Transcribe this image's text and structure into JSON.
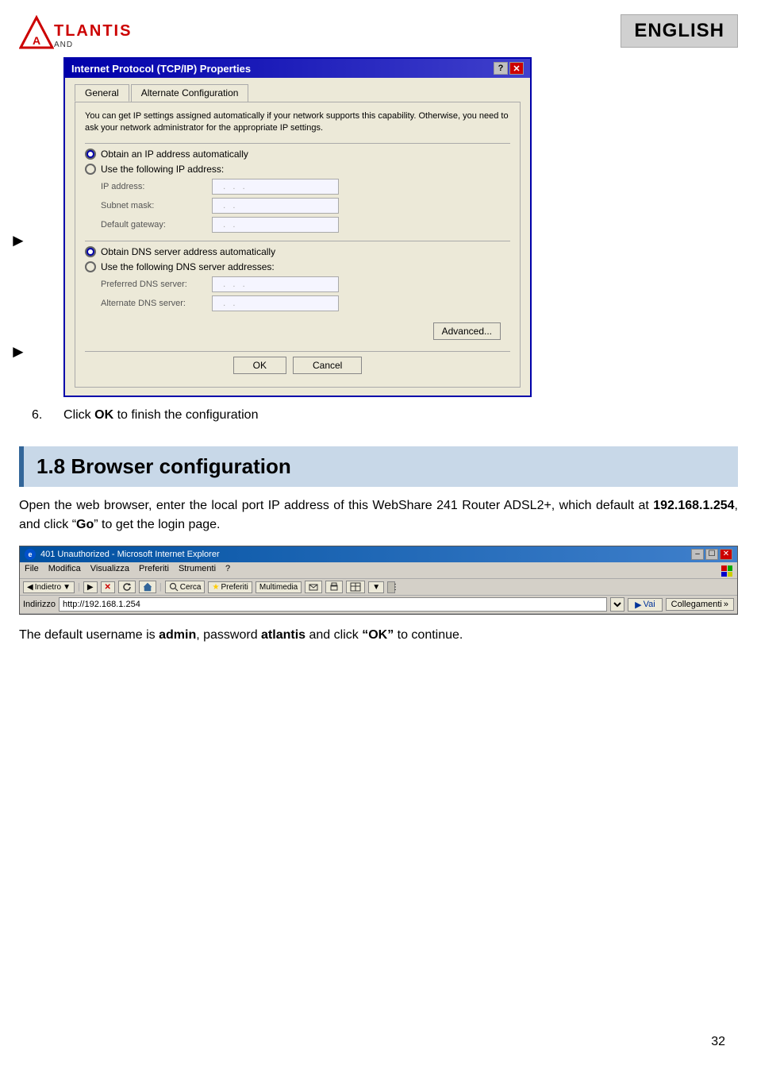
{
  "header": {
    "logo_text": "TLANTIS",
    "logo_reg": "®",
    "logo_subtitle": "AND",
    "english_badge": "ENGLISH"
  },
  "dialog": {
    "title": "Internet Protocol (TCP/IP) Properties",
    "tabs": [
      {
        "label": "General",
        "active": true
      },
      {
        "label": "Alternate Configuration",
        "active": false
      }
    ],
    "description": "You can get IP settings assigned automatically if your network supports this capability. Otherwise, you need to ask your network administrator for the appropriate IP settings.",
    "ip_section": {
      "auto_radio": "Obtain an IP address automatically",
      "manual_radio": "Use the following IP address:",
      "fields": [
        {
          "label": "IP address:",
          "value": ". . ."
        },
        {
          "label": "Subnet mask:",
          "value": ". ."
        },
        {
          "label": "Default gateway:",
          "value": ". ."
        }
      ]
    },
    "dns_section": {
      "auto_radio": "Obtain DNS server address automatically",
      "manual_radio": "Use the following DNS server addresses:",
      "fields": [
        {
          "label": "Preferred DNS server:",
          "value": ". . ."
        },
        {
          "label": "Alternate DNS server:",
          "value": ". ."
        }
      ]
    },
    "advanced_btn": "Advanced...",
    "ok_btn": "OK",
    "cancel_btn": "Cancel"
  },
  "step6": {
    "number": "6.",
    "text": "Click ",
    "bold": "OK",
    "rest": " to finish the configuration"
  },
  "section18": {
    "title": "1.8 Browser configuration",
    "body_part1": "Open the web browser, enter the local port IP address of this WebShare 241 Router ADSL2+, which default at ",
    "body_ip": "192.168.1.254",
    "body_part2": ", and click “",
    "body_go": "Go",
    "body_part3": "” to get the login page."
  },
  "browser": {
    "title": "401 Unauthorized - Microsoft Internet Explorer",
    "menu_items": [
      "File",
      "Modifica",
      "Visualizza",
      "Preferiti",
      "Strumenti",
      "?"
    ],
    "toolbar_buttons": [
      "Indietro",
      "Avanti",
      "Stop",
      "Aggiorna",
      "Home",
      "Cerca",
      "Preferiti",
      "Multimedia"
    ],
    "address_label": "Indirizzo",
    "address_value": "http://192.168.1.254",
    "go_label": "Vai",
    "links_label": "Collegamenti"
  },
  "bottom_text": {
    "part1": "The default username is ",
    "username": "admin",
    "part2": ", password ",
    "password": "atlantis",
    "part3": " and click ",
    "ok": "“OK”",
    "part4": " to continue."
  },
  "page_number": "32"
}
